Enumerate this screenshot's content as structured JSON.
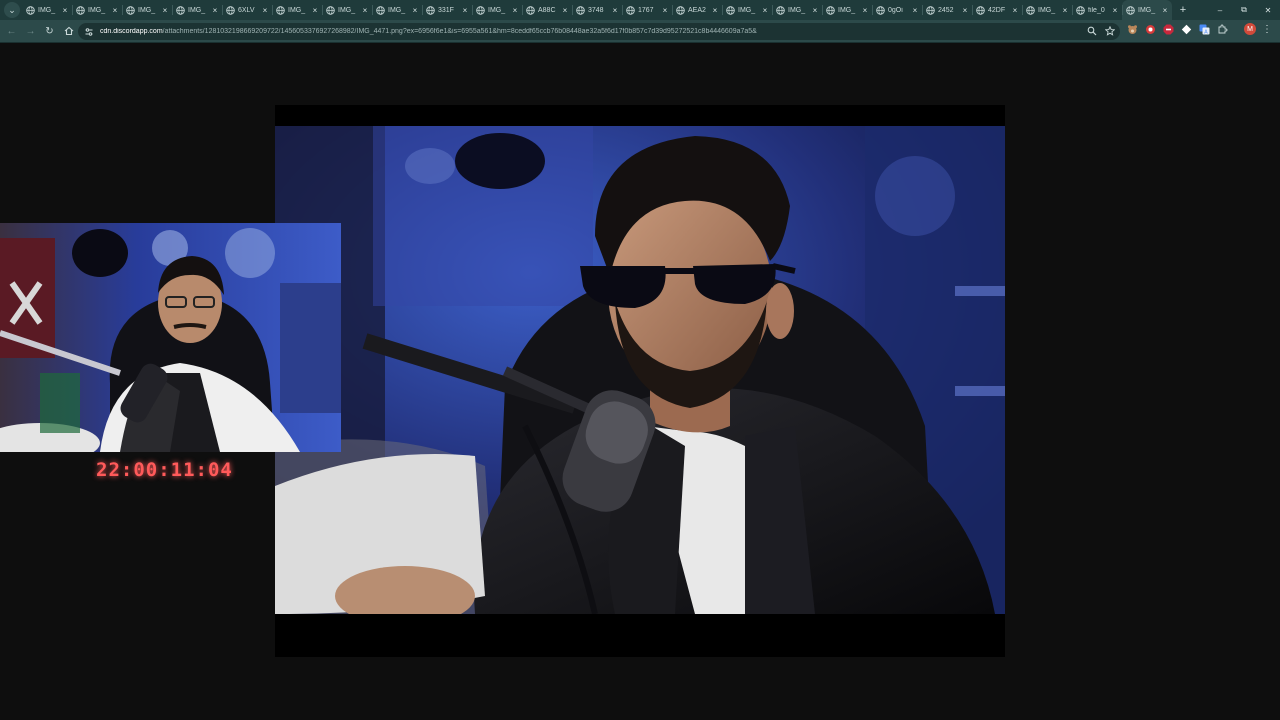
{
  "browser": {
    "tab_menu_icon": "chevron-down-icon",
    "tabs": [
      {
        "title": "IMG_",
        "icon": "globe-icon"
      },
      {
        "title": "IMG_",
        "icon": "globe-icon"
      },
      {
        "title": "IMG_",
        "icon": "globe-icon"
      },
      {
        "title": "IMG_",
        "icon": "globe-icon"
      },
      {
        "title": "6XLV",
        "icon": "globe-icon"
      },
      {
        "title": "IMG_",
        "icon": "globe-icon"
      },
      {
        "title": "IMG_",
        "icon": "globe-icon"
      },
      {
        "title": "IMG_",
        "icon": "globe-icon"
      },
      {
        "title": "331F",
        "icon": "globe-icon"
      },
      {
        "title": "IMG_",
        "icon": "globe-icon"
      },
      {
        "title": "A88C",
        "icon": "globe-icon"
      },
      {
        "title": "3748",
        "icon": "globe-icon"
      },
      {
        "title": "1767",
        "icon": "globe-icon"
      },
      {
        "title": "AEA2",
        "icon": "globe-icon"
      },
      {
        "title": "IMG_",
        "icon": "globe-icon"
      },
      {
        "title": "IMG_",
        "icon": "globe-icon"
      },
      {
        "title": "IMG_",
        "icon": "globe-icon"
      },
      {
        "title": "0gOi",
        "icon": "globe-icon"
      },
      {
        "title": "2452",
        "icon": "globe-icon"
      },
      {
        "title": "42DF",
        "icon": "globe-icon"
      },
      {
        "title": "IMG_",
        "icon": "globe-icon"
      },
      {
        "title": "file_0",
        "icon": "globe-icon"
      },
      {
        "title": "IMG_",
        "icon": "globe-icon"
      }
    ],
    "active_tab_index": 22,
    "tab_close_glyph": "×",
    "new_tab_glyph": "+",
    "window_controls": [
      "–",
      "⧉",
      "✕"
    ],
    "url_host": "cdn.discordapp.com",
    "url_path": "/attachments/1281032198669209722/1456053376927268982/IMG_4471.png?ex=6956f6e1&is=6955a561&hm=8ceddf65ccb76b08448ae32a5f6d17f0b857c7d39d95272521c8b4446609a7a5&",
    "profile_initial": "M",
    "extensions": [
      "bear-icon",
      "record-icon",
      "stop-icon",
      "diamond-icon",
      "translate-icon",
      "puzzle-icon"
    ]
  },
  "stream": {
    "timer": "22:00:11:04",
    "timer_color": "#ff5a5a"
  },
  "colors": {
    "tabstrip_bg": "#1f3b3b",
    "toolbar_bg": "#2c4a4a",
    "viewer_bg": "#0e0e0e"
  }
}
